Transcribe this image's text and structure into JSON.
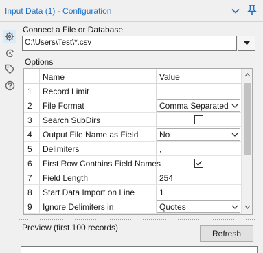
{
  "window": {
    "title": "Input Data (1) - Configuration"
  },
  "rail": {
    "icons": [
      "gear-icon",
      "annotation-icon",
      "tag-icon",
      "help-icon"
    ]
  },
  "connect": {
    "label": "Connect a File or Database",
    "path_value": "C:\\Users\\Test\\*.csv"
  },
  "options": {
    "label": "Options",
    "columns": [
      "Name",
      "Value"
    ],
    "rows": [
      {
        "num": "1",
        "name": "Record Limit",
        "value": "",
        "kind": "text"
      },
      {
        "num": "2",
        "name": "File Format",
        "value": "Comma Separated V",
        "kind": "dropdown"
      },
      {
        "num": "3",
        "name": "Search SubDirs",
        "value": "",
        "kind": "checkbox",
        "checked": false
      },
      {
        "num": "4",
        "name": "Output File Name as Field",
        "value": "No",
        "kind": "dropdown"
      },
      {
        "num": "5",
        "name": "Delimiters",
        "value": ",",
        "kind": "text"
      },
      {
        "num": "6",
        "name": "First Row Contains Field Names",
        "value": "",
        "kind": "checkbox",
        "checked": true
      },
      {
        "num": "7",
        "name": "Field Length",
        "value": "254",
        "kind": "text"
      },
      {
        "num": "8",
        "name": "Start Data Import on Line",
        "value": "1",
        "kind": "text"
      },
      {
        "num": "9",
        "name": "Ignore Delimiters in",
        "value": "Quotes",
        "kind": "dropdown"
      }
    ]
  },
  "preview": {
    "label": "Preview (first 100 records)",
    "refresh_label": "Refresh"
  },
  "colors": {
    "title": "#1f6fc4",
    "accent": "#1f6fc4",
    "background": "#f0f0f0"
  }
}
